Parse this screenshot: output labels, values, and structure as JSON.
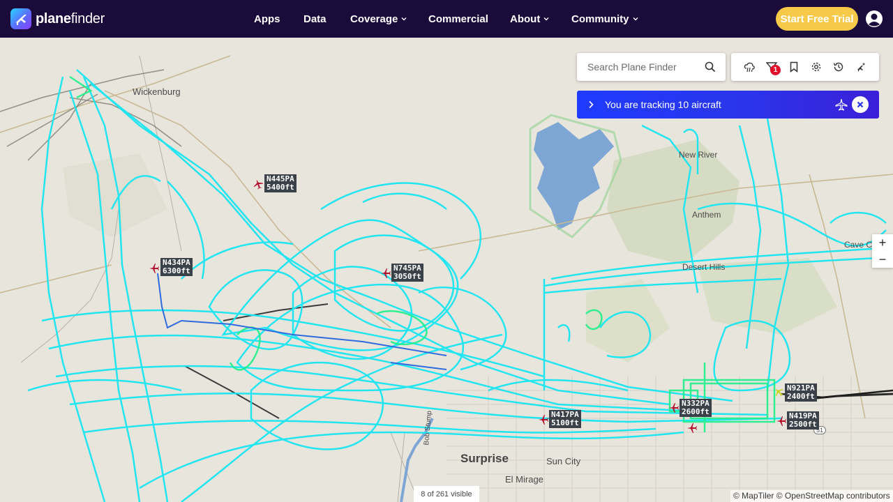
{
  "brand": {
    "name_a": "plane",
    "name_b": "finder"
  },
  "nav": [
    {
      "label": "Apps",
      "has_menu": false
    },
    {
      "label": "Data",
      "has_menu": false
    },
    {
      "label": "Coverage",
      "has_menu": true
    },
    {
      "label": "Commercial",
      "has_menu": false
    },
    {
      "label": "About",
      "has_menu": true
    },
    {
      "label": "Community",
      "has_menu": true
    }
  ],
  "cta": {
    "label": "Start Free Trial"
  },
  "search": {
    "placeholder": "Search Plane Finder"
  },
  "tools": {
    "filter_badge": "1",
    "icons": [
      "weather-icon",
      "filter-icon",
      "bookmark-icon",
      "settings-icon",
      "history-icon",
      "ar-view-icon"
    ]
  },
  "tracking": {
    "text": "You are tracking 10 aircraft"
  },
  "zoom": {
    "in": "+",
    "out": "−"
  },
  "status": {
    "visible": "8 of 261 visible"
  },
  "attribution": "© MapTiler © OpenStreetMap contributors",
  "places": {
    "wickenburg": "Wickenburg",
    "new_river": "New River",
    "anthem": "Anthem",
    "desert_hills": "Desert Hills",
    "cave_creek": "Cave Cr",
    "surprise": "Surprise",
    "sun_city": "Sun City",
    "el_mirage": "El Mirage",
    "bob_stump": "Bob Stump",
    "route_51": "51"
  },
  "aircraft": [
    {
      "callsign": "N445PA",
      "altitude": "5400ft"
    },
    {
      "callsign": "N434PA",
      "altitude": "6300ft"
    },
    {
      "callsign": "N745PA",
      "altitude": "3050ft"
    },
    {
      "callsign": "N921PA",
      "altitude": "2400ft"
    },
    {
      "callsign": "N332PA",
      "altitude": "2600ft"
    },
    {
      "callsign": "N419PA",
      "altitude": "2500ft"
    },
    {
      "callsign": "N417PA",
      "altitude": "5100ft"
    }
  ],
  "colors": {
    "nav_bg": "#1a0b3a",
    "cta": "#f7c948",
    "track_cyan": "#19e6f2",
    "track_green": "#1ff08a",
    "aircraft": "#b3122e",
    "tracking_bar": "#2a35ea"
  }
}
